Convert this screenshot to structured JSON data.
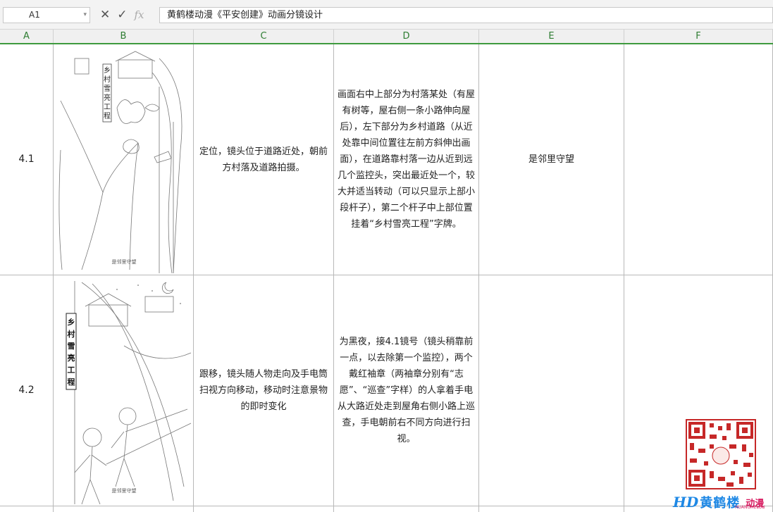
{
  "formula_bar": {
    "cell_ref": "A1",
    "content": "黄鹤楼动漫《平安创建》动画分镜设计"
  },
  "columns": [
    "A",
    "B",
    "C",
    "D",
    "E",
    "F"
  ],
  "rows": [
    {
      "id": "4.1",
      "sketch_sign": "乡村雪亮工程",
      "sketch_caption": "是邻里守望",
      "camera": "定位，镜头位于道路近处，朝前方村落及道路拍摄。",
      "description": "画面右中上部分为村落某处（有屋有树等，屋右侧一条小路伸向屋后），左下部分为乡村道路（从近处靠中间位置往左前方斜伸出画面），在道路靠村落一边从近到远几个监控头，突出最近处一个，较大并适当转动（可以只显示上部小段杆子），第二个杆子中上部位置挂着“乡村雪亮工程”字牌。",
      "voiceover": "是邻里守望",
      "notes": ""
    },
    {
      "id": "4.2",
      "sketch_sign": "乡村雪亮工程",
      "sketch_caption": "是邻里守望",
      "camera": "跟移，镜头随人物走向及手电筒扫视方向移动，移动时注意景物的即时变化",
      "description": "为黑夜，接4.1镜号（镜头稍靠前一点，以去除第一个监控），两个戴红袖章（两袖章分别有“志愿”、“巡查”字样）的人拿着手电从大路近处走到屋角右侧小路上巡查，手电朝前右不同方向进行扫视。",
      "voiceover": "",
      "notes": ""
    }
  ],
  "watermark": {
    "brand": "黄鹤楼",
    "suffix": "动漫",
    "english": "HUANGHELOU"
  }
}
